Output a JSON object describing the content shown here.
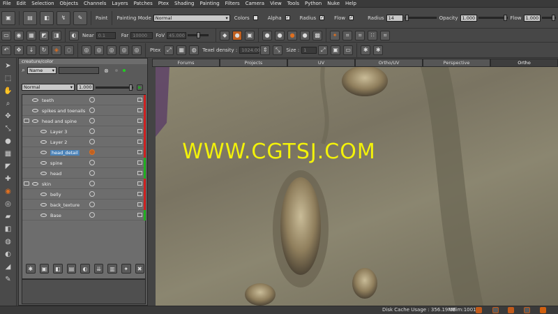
{
  "menubar": [
    "File",
    "Edit",
    "Selection",
    "Objects",
    "Channels",
    "Layers",
    "Patches",
    "Ptex",
    "Shading",
    "Painting",
    "Filters",
    "Camera",
    "View",
    "Tools",
    "Python",
    "Nuke",
    "Help"
  ],
  "toolbar1": {
    "paint_label": "Paint",
    "painting_mode_label": "Painting Mode",
    "painting_mode_value": "Normal",
    "colors_label": "Colors",
    "alpha_label": "Alpha",
    "radius_label": "Radius",
    "flow_label": "Flow",
    "radius_value_label": "Radius",
    "radius_value": "14",
    "opacity_label": "Opacity",
    "opacity_value": "1.000",
    "flow_value_label": "Flow",
    "flow_value": "1.000"
  },
  "toolbar2": {
    "near_label": "Near",
    "near_value": "0.1",
    "far_label": "Far",
    "far_value": "10000",
    "fov_label": "FoV",
    "fov_value": "45.000"
  },
  "toolbar3": {
    "ptex_label": "Ptex",
    "texel_density_label": "Texel density :",
    "texel_density_value": "1024.000",
    "size_label": "Size :",
    "size_value": "1"
  },
  "panel": {
    "title": "creature/color",
    "filter_mode": "Name",
    "filter_value": "",
    "blend_mode": "Normal",
    "opacity": "1.000"
  },
  "layers": [
    {
      "name": "teeth",
      "indent": 0,
      "folder": false,
      "status": "#d02020",
      "selected": false
    },
    {
      "name": "spikes and toenails",
      "indent": 0,
      "folder": false,
      "status": "#d02020",
      "selected": false
    },
    {
      "name": "head and spine",
      "indent": 0,
      "folder": true,
      "status": "#d02020",
      "selected": false
    },
    {
      "name": "Layer 3",
      "indent": 1,
      "folder": false,
      "status": "#d02020",
      "selected": false
    },
    {
      "name": "Layer 2",
      "indent": 1,
      "folder": false,
      "status": "#d02020",
      "selected": false
    },
    {
      "name": "head_detail",
      "indent": 1,
      "folder": false,
      "status": "#d02020",
      "selected": true
    },
    {
      "name": "spine",
      "indent": 1,
      "folder": false,
      "status": "#20b020",
      "selected": false
    },
    {
      "name": "head",
      "indent": 1,
      "folder": false,
      "status": "#20b020",
      "selected": false
    },
    {
      "name": "skin",
      "indent": 0,
      "folder": true,
      "status": "#d02020",
      "selected": false
    },
    {
      "name": "belly",
      "indent": 1,
      "folder": false,
      "status": "#d02020",
      "selected": false
    },
    {
      "name": "back_texture",
      "indent": 1,
      "folder": false,
      "status": "#d02020",
      "selected": false
    },
    {
      "name": "Base",
      "indent": 1,
      "folder": false,
      "status": "#20b020",
      "selected": false
    }
  ],
  "view_tabs": [
    "Forums",
    "Projects",
    "UV",
    "Ortho/UV",
    "Perspective",
    "Ortho"
  ],
  "active_tab": 5,
  "statusbar": {
    "disk_cache": "Disk Cache Usage : 356.19MB",
    "udim": "Udim:1001"
  },
  "watermark": "WWW.CGTSJ.COM",
  "colors": {
    "selection": "#4a82b8",
    "watermark": "#f3f20a"
  }
}
